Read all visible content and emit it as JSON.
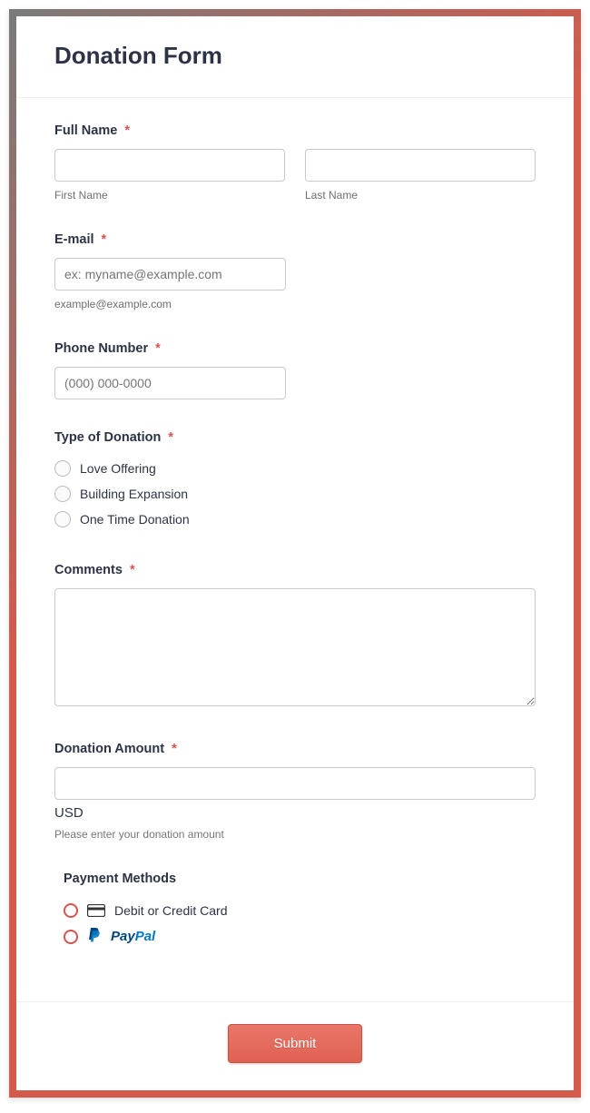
{
  "title": "Donation Form",
  "fullName": {
    "label": "Full Name",
    "firstSub": "First Name",
    "lastSub": "Last Name"
  },
  "email": {
    "label": "E-mail",
    "placeholder": "ex: myname@example.com",
    "sub": "example@example.com"
  },
  "phone": {
    "label": "Phone Number",
    "placeholder": "(000) 000-0000"
  },
  "donationType": {
    "label": "Type of Donation",
    "opt1": "Love Offering",
    "opt2": "Building Expansion",
    "opt3": "One Time Donation"
  },
  "comments": {
    "label": "Comments"
  },
  "amount": {
    "label": "Donation Amount",
    "currency": "USD",
    "helper": "Please enter your donation amount"
  },
  "payment": {
    "label": "Payment Methods",
    "opt1": "Debit or Credit Card",
    "paypal_a": "Pay",
    "paypal_b": "Pal"
  },
  "submit": "Submit",
  "asterisk": "*"
}
